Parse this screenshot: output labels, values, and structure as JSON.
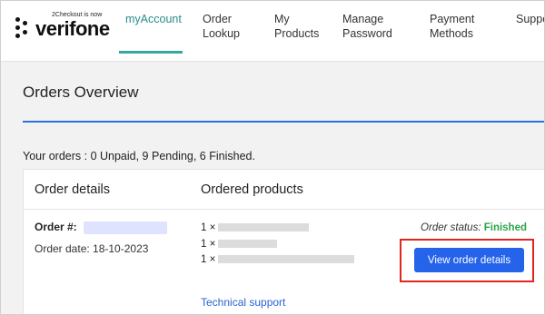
{
  "logo": {
    "tag": "2Checkout is now",
    "brand": "verifone"
  },
  "nav": [
    {
      "label": "myAccount"
    },
    {
      "label": "Order\nLookup"
    },
    {
      "label": "My\nProducts"
    },
    {
      "label": "Manage\nPassword"
    },
    {
      "label": "Payment\nMethods"
    },
    {
      "label": "Support"
    }
  ],
  "page": {
    "title": "Orders Overview",
    "summary": "Your orders : 0 Unpaid, 9 Pending, 6 Finished."
  },
  "card": {
    "col_order_details": "Order details",
    "col_ordered_products": "Ordered products",
    "order_no_label": "Order #:",
    "order_date": "Order date: 18-10-2023",
    "products": [
      {
        "qty": "1 ×"
      },
      {
        "qty": "1 ×"
      },
      {
        "qty": "1 ×"
      }
    ],
    "status_label": "Order status:",
    "status_value": "Finished",
    "view_button": "View order details",
    "support_link": "Technical support"
  },
  "colors": {
    "accent_teal": "#37a6a0",
    "primary_blue": "#2563eb",
    "status_green": "#2ea34b",
    "highlight_red": "#e0261d"
  }
}
